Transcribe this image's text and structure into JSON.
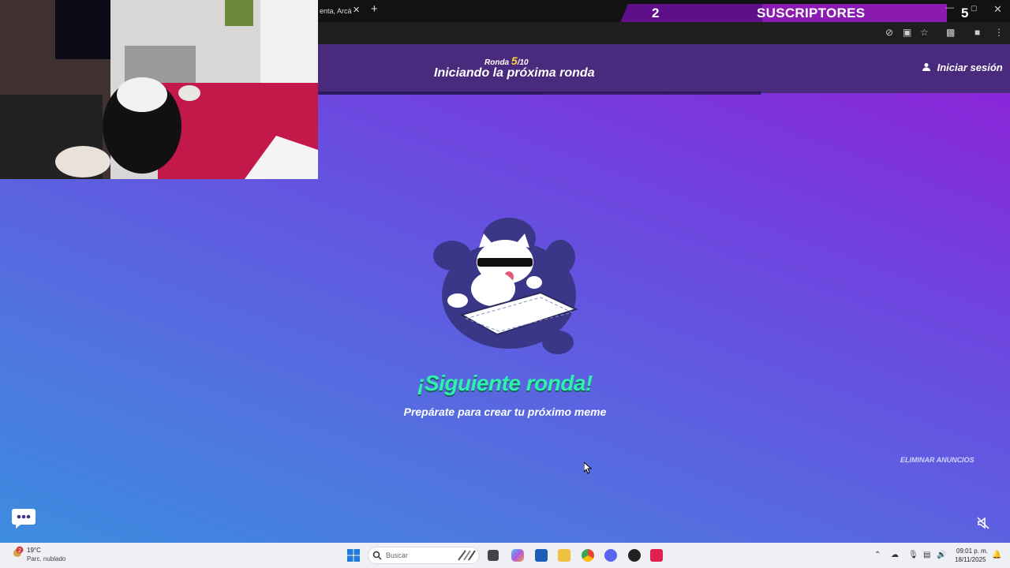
{
  "browser": {
    "tab_title": "enta, Arcá",
    "tab_close": "✕",
    "new_tab": "+"
  },
  "overlay": {
    "subs_count": "2",
    "subs_label": "SUSCRIPTORES",
    "subs_extra": "5"
  },
  "header": {
    "round_prefix": "Ronda",
    "round_current": "5",
    "round_total": "/10",
    "title": "Iniciando la próxima ronda",
    "login_label": "Iniciar sesión",
    "round_progress": 0.5
  },
  "main": {
    "heading": "¡Siguiente ronda!",
    "subtitle": "Prepárate para crear tu próximo meme",
    "remove_ads": "ELIMINAR ANUNCIOS"
  },
  "taskbar": {
    "weather_temp": "19°C",
    "weather_desc": "Parc. nublado",
    "weather_badge": "2",
    "search_placeholder": "Buscar",
    "time": "09:01 p. m.",
    "date": "18/11/2025"
  },
  "colors": {
    "accent_green": "#2ff0b0",
    "header_bg": "#4a2a7c",
    "overlay_purple": "#8a1ab0"
  }
}
